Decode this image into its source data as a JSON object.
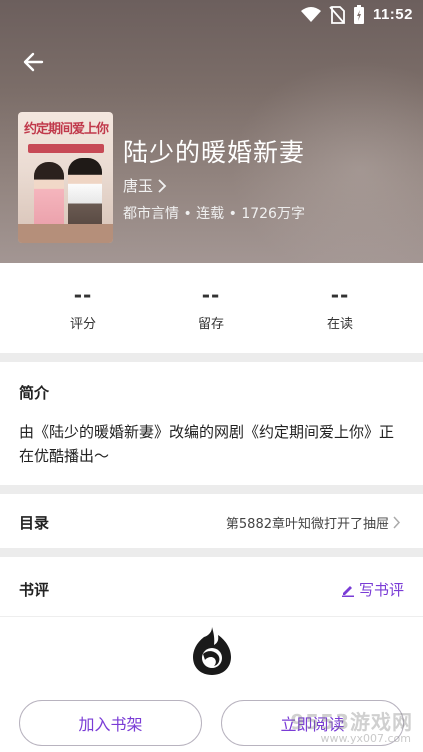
{
  "status_bar": {
    "time": "11:52"
  },
  "book": {
    "title": "陆少的暖婚新妻",
    "author": "唐玉",
    "meta": "都市言情 • 连载 • 1726万字",
    "cover_title": "约定期间爱上你"
  },
  "stats": [
    {
      "value": "--",
      "label": "评分"
    },
    {
      "value": "--",
      "label": "留存"
    },
    {
      "value": "--",
      "label": "在读"
    }
  ],
  "intro": {
    "title": "简介",
    "text": "由《陆少的暖婚新妻》改编的网剧《约定期间爱上你》正在优酷播出～"
  },
  "toc": {
    "title": "目录",
    "latest": "第5882章叶知微打开了抽屉"
  },
  "review": {
    "title": "书评",
    "write_label": "写书评"
  },
  "bottom": {
    "add_shelf_label": "加入书架",
    "read_label": "立即阅读"
  },
  "watermark": {
    "main": "9553游戏网",
    "sub": "www.yx007.com"
  },
  "colors": {
    "accent": "#7a3cd6",
    "header_bg": "#7c6e69",
    "divider": "#ececec"
  }
}
